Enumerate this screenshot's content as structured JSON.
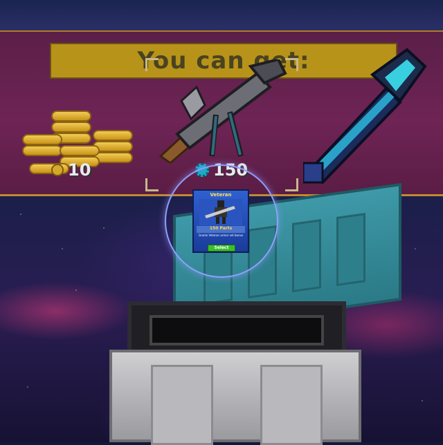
{
  "banner": {
    "title": "You can get:",
    "rewards": [
      {
        "kind": "coins",
        "amount": "10",
        "icon": "coin-icon"
      },
      {
        "kind": "weapon-minigun",
        "amount": "150",
        "icon": "gear-icon"
      },
      {
        "kind": "weapon-pixel-sword",
        "amount": ""
      }
    ]
  },
  "card": {
    "title": "Veteran",
    "price": "150 Parts",
    "description": "Grants Veteran armor set bonus",
    "select_label": "Select"
  },
  "colors": {
    "banner_bg": "#6e2455",
    "title_bar": "#b8931a",
    "chest_lid": "#3e99a8",
    "card_bg": "#3060d0",
    "select_button": "#3cbf2c"
  }
}
